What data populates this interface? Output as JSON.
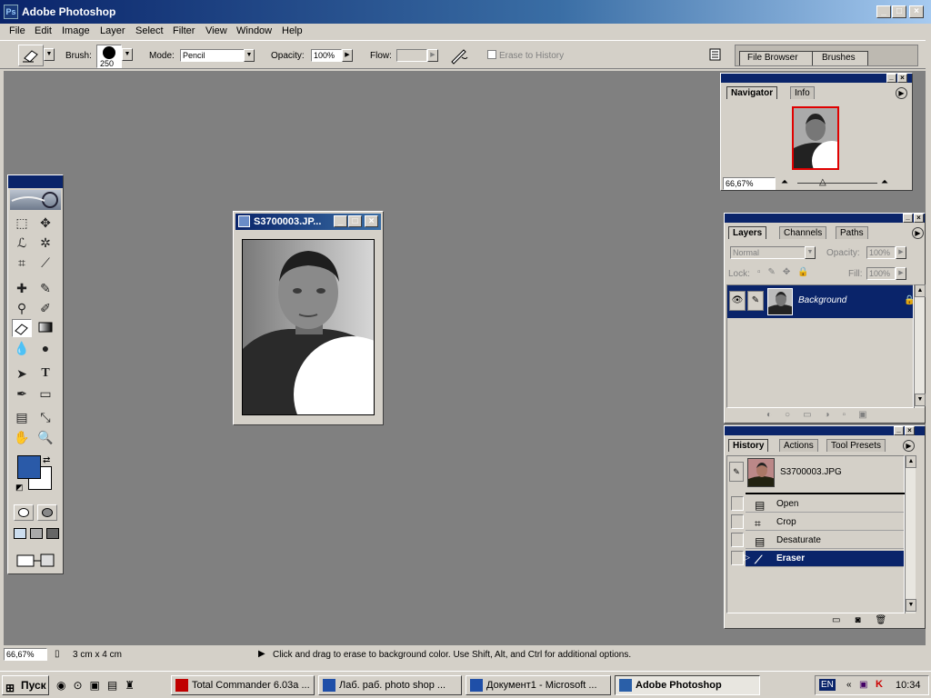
{
  "app": {
    "title": "Adobe Photoshop"
  },
  "menu": [
    "File",
    "Edit",
    "Image",
    "Layer",
    "Select",
    "Filter",
    "View",
    "Window",
    "Help"
  ],
  "options": {
    "brush_label": "Brush:",
    "brush_size": "250",
    "mode_label": "Mode:",
    "mode_value": "Pencil",
    "opacity_label": "Opacity:",
    "opacity_value": "100%",
    "flow_label": "Flow:",
    "erase_history_label": "Erase to History",
    "file_browser_tab": "File Browser",
    "brushes_tab": "Brushes"
  },
  "document": {
    "title": "S3700003.JP..."
  },
  "navigator": {
    "tab_navigator": "Navigator",
    "tab_info": "Info",
    "zoom": "66,67%"
  },
  "layers": {
    "tab_layers": "Layers",
    "tab_channels": "Channels",
    "tab_paths": "Paths",
    "blend_mode": "Normal",
    "opacity_label": "Opacity:",
    "opacity_value": "100%",
    "lock_label": "Lock:",
    "fill_label": "Fill:",
    "fill_value": "100%",
    "layer_name": "Background"
  },
  "history": {
    "tab_history": "History",
    "tab_actions": "Actions",
    "tab_presets": "Tool Presets",
    "snapshot": "S3700003.JPG",
    "steps": [
      {
        "label": "Open",
        "icon": "document-icon",
        "selected": false
      },
      {
        "label": "Crop",
        "icon": "crop-icon",
        "selected": false
      },
      {
        "label": "Desaturate",
        "icon": "document-icon",
        "selected": false
      },
      {
        "label": "Eraser",
        "icon": "eraser-icon",
        "selected": true
      }
    ]
  },
  "status": {
    "zoom": "66,67%",
    "doc_size": "3 cm x 4 cm",
    "hint": "Click and drag to erase to background color.  Use Shift, Alt, and Ctrl for additional options."
  },
  "taskbar": {
    "start": "Пуск",
    "tasks": [
      {
        "label": "Total Commander 6.03a ...",
        "active": false,
        "color": "#c00000"
      },
      {
        "label": "Лаб. раб. photo shop ...",
        "active": false,
        "color": "#1f4fa8"
      },
      {
        "label": "Документ1 - Microsoft ...",
        "active": false,
        "color": "#1f4fa8"
      },
      {
        "label": "Adobe Photoshop",
        "active": true,
        "color": "#2a5fa8"
      }
    ],
    "lang": "EN",
    "clock": "10:34"
  },
  "colors": {
    "foreground": "#2a5aa8",
    "background": "#ffffff",
    "selection": "#0a246a"
  }
}
